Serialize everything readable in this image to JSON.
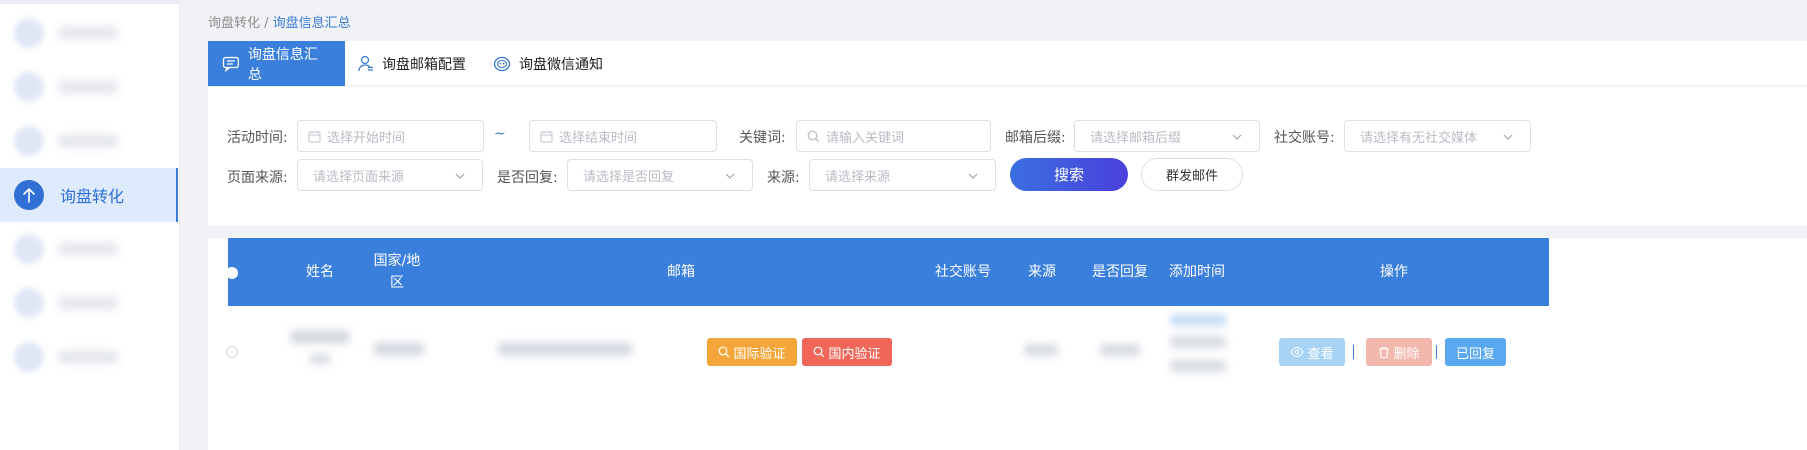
{
  "sidebar": {
    "active_item_label": "询盘转化",
    "active_icon": "arrow-up-icon"
  },
  "breadcrumb": {
    "parent": "询盘转化",
    "separator": " / ",
    "current": "询盘信息汇总"
  },
  "tabs": [
    {
      "label": "询盘信息汇总",
      "icon": "chat-icon",
      "active": true
    },
    {
      "label": "询盘邮箱配置",
      "icon": "user-config-icon",
      "active": false
    },
    {
      "label": "询盘微信通知",
      "icon": "wechat-icon",
      "active": false
    }
  ],
  "filters": {
    "activity_time_label": "活动时间:",
    "start_time_placeholder": "选择开始时间",
    "range_separator": "~",
    "end_time_placeholder": "选择结束时间",
    "keyword_label": "关键词:",
    "keyword_placeholder": "请输入关键词",
    "email_suffix_label": "邮箱后缀:",
    "email_suffix_placeholder": "请选择邮箱后缀",
    "social_label": "社交账号:",
    "social_placeholder": "请选择有无社交媒体",
    "page_source_label": "页面来源:",
    "page_source_placeholder": "请选择页面来源",
    "replied_label": "是否回复:",
    "replied_placeholder": "请选择是否回复",
    "source_label": "来源:",
    "source_placeholder": "请选择来源",
    "search_button": "搜索",
    "mass_email_button": "群发邮件"
  },
  "table": {
    "columns": [
      "姓名",
      "国家/地区",
      "邮箱",
      "社交账号",
      "来源",
      "是否回复",
      "添加时间",
      "操作"
    ],
    "row": {
      "intl_verify_button": "国际验证",
      "domestic_verify_button": "国内验证",
      "view_button": "查看",
      "delete_button": "删除",
      "replied_button": "已回复"
    }
  },
  "colors": {
    "primary": "#3b7fdc",
    "intl_verify": "#f5a63a",
    "domestic_verify": "#f0675a",
    "view": "#a9d3f5",
    "delete": "#f2b8ae",
    "replied": "#5aa8ef"
  }
}
